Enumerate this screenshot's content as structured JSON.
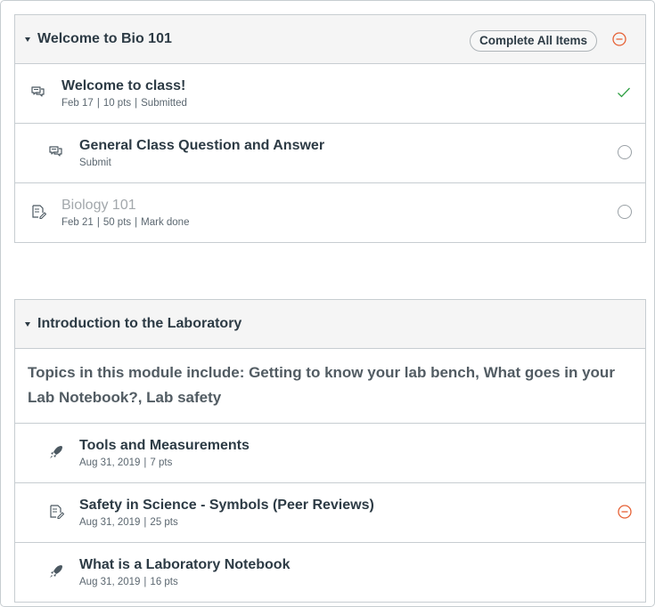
{
  "modules": [
    {
      "title": "Welcome to Bio 101",
      "complete_button": "Complete All Items",
      "items": [
        {
          "title": "Welcome to class!",
          "meta": [
            "Feb 17",
            "10 pts",
            "Submitted"
          ],
          "icon": "discussion-icon",
          "status": "checkmark-icon"
        },
        {
          "title": "General Class Question and Answer",
          "meta": [
            "Submit"
          ],
          "icon": "discussion-icon",
          "status": "empty-circle-icon"
        },
        {
          "title": "Biology 101",
          "meta": [
            "Feb 21",
            "50 pts",
            "Mark done"
          ],
          "icon": "assignment-icon",
          "status": "empty-circle-icon"
        }
      ]
    },
    {
      "title": "Introduction to the Laboratory",
      "description": "Topics in this module include: Getting to know your lab bench, What goes in your Lab Notebook?, Lab safety",
      "items": [
        {
          "title": "Tools and Measurements",
          "meta": [
            "Aug 31, 2019",
            "7 pts"
          ],
          "icon": "quiz-rocket-icon"
        },
        {
          "title": "Safety in Science - Symbols (Peer Reviews)",
          "meta": [
            "Aug 31, 2019",
            "25 pts"
          ],
          "icon": "assignment-icon",
          "status": "minus-circle-icon"
        },
        {
          "title": "What is a Laboratory Notebook",
          "meta": [
            "Aug 31, 2019",
            "16 pts"
          ],
          "icon": "quiz-rocket-icon"
        }
      ]
    }
  ],
  "colors": {
    "accent_orange": "#e66135",
    "success_green": "#2fa043",
    "text": "#2d3b45"
  }
}
